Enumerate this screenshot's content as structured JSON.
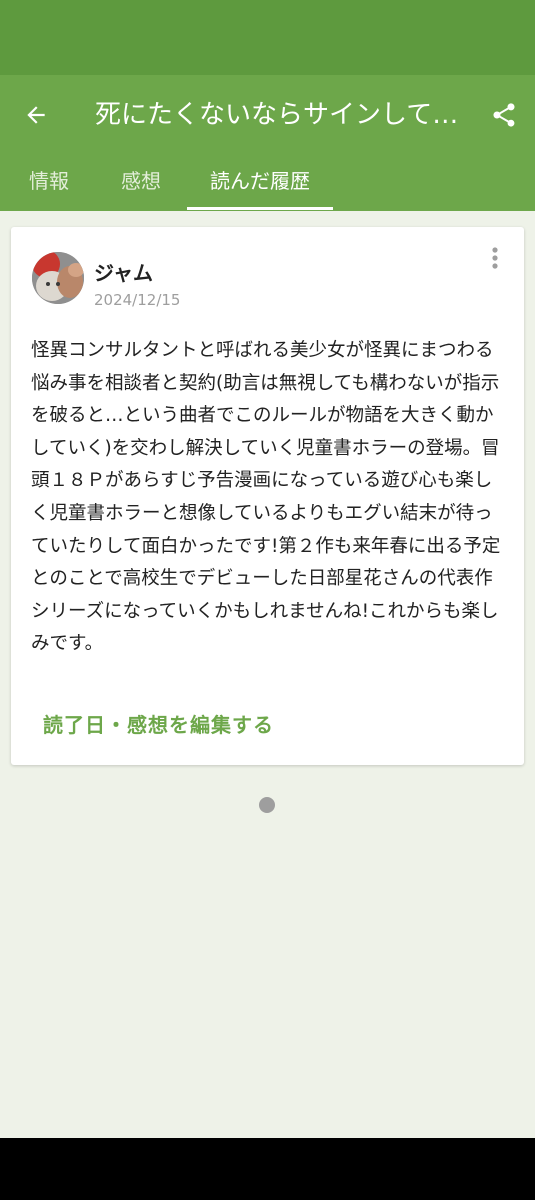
{
  "header": {
    "title": "死にたくないならサインして　怪異コンサルタント",
    "back_icon": "arrow-left-icon",
    "share_icon": "share-icon"
  },
  "tabs": [
    {
      "label": "情報",
      "active": false
    },
    {
      "label": "感想",
      "active": false
    },
    {
      "label": "読んだ履歴",
      "active": true
    }
  ],
  "review": {
    "user": "ジャム",
    "date": "2024/12/15",
    "text": "怪異コンサルタントと呼ばれる美少女が怪異にまつわる悩み事を相談者と契約(助言は無視しても構わないが指示を破ると…という曲者でこのルールが物語を大きく動かしていく)を交わし解決していく児童書ホラーの登場。冒頭１８Ｐがあらすじ予告漫画になっている遊び心も楽しく児童書ホラーと想像しているよりもエグい結末が待っていたりして面白かったです!第２作も来年春に出る予定とのことで高校生でデビューした日部星花さんの代表作シリーズになっていくかもしれませんね!これからも楽しみです。",
    "edit_label": "読了日・感想を編集する",
    "more_icon": "more-vert-icon"
  },
  "colors": {
    "status_bar": "#5e9a3e",
    "app_bar": "#6da74a",
    "background": "#eef2e8",
    "accent": "#6da74a"
  }
}
